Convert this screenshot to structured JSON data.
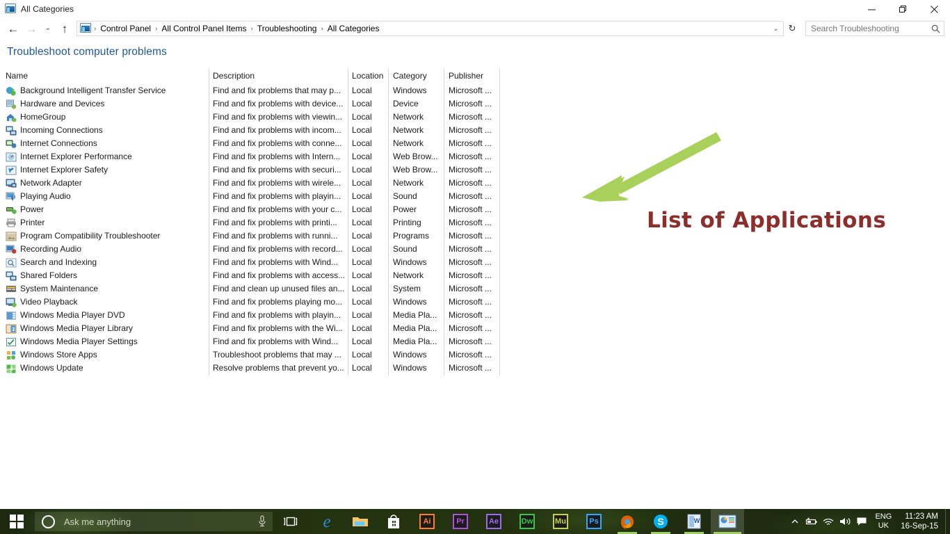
{
  "window": {
    "title": "All Categories",
    "icon": "control-panel-icon",
    "buttons": {
      "minimize": "—",
      "maximize": "❐",
      "close": "✕"
    }
  },
  "addressbar": {
    "back": "←",
    "forward": "→",
    "recent_chevron": "⌄",
    "up": "↑",
    "crumbs": [
      "Control Panel",
      "All Control Panel Items",
      "Troubleshooting",
      "All Categories"
    ],
    "separator": "›",
    "dropdown": "⌄",
    "refresh": "↻"
  },
  "search": {
    "placeholder": "Search Troubleshooting",
    "value": "",
    "icon": "search-icon"
  },
  "page": {
    "title": "Troubleshoot computer problems"
  },
  "table": {
    "columns": [
      "Name",
      "Description",
      "Location",
      "Category",
      "Publisher"
    ],
    "rows": [
      {
        "icon": "bits-icon",
        "name": "Background Intelligent Transfer Service",
        "description": "Find and fix problems that may p...",
        "location": "Local",
        "category": "Windows",
        "publisher": "Microsoft ..."
      },
      {
        "icon": "hardware-icon",
        "name": "Hardware and Devices",
        "description": "Find and fix problems with device...",
        "location": "Local",
        "category": "Device",
        "publisher": "Microsoft ..."
      },
      {
        "icon": "homegroup-icon",
        "name": "HomeGroup",
        "description": "Find and fix problems with viewin...",
        "location": "Local",
        "category": "Network",
        "publisher": "Microsoft ..."
      },
      {
        "icon": "incoming-connections-icon",
        "name": "Incoming Connections",
        "description": "Find and fix problems with incom...",
        "location": "Local",
        "category": "Network",
        "publisher": "Microsoft ..."
      },
      {
        "icon": "internet-connections-icon",
        "name": "Internet Connections",
        "description": "Find and fix problems with conne...",
        "location": "Local",
        "category": "Network",
        "publisher": "Microsoft ..."
      },
      {
        "icon": "ie-performance-icon",
        "name": "Internet Explorer Performance",
        "description": "Find and fix problems with Intern...",
        "location": "Local",
        "category": "Web Brow...",
        "publisher": "Microsoft ..."
      },
      {
        "icon": "ie-safety-icon",
        "name": "Internet Explorer Safety",
        "description": "Find and fix problems with securi...",
        "location": "Local",
        "category": "Web Brow...",
        "publisher": "Microsoft ..."
      },
      {
        "icon": "network-adapter-icon",
        "name": "Network Adapter",
        "description": "Find and fix problems with wirele...",
        "location": "Local",
        "category": "Network",
        "publisher": "Microsoft ..."
      },
      {
        "icon": "playing-audio-icon",
        "name": "Playing Audio",
        "description": "Find and fix problems with playin...",
        "location": "Local",
        "category": "Sound",
        "publisher": "Microsoft ..."
      },
      {
        "icon": "power-icon",
        "name": "Power",
        "description": "Find and fix problems with your c...",
        "location": "Local",
        "category": "Power",
        "publisher": "Microsoft ..."
      },
      {
        "icon": "printer-icon",
        "name": "Printer",
        "description": "Find and fix problems with printi...",
        "location": "Local",
        "category": "Printing",
        "publisher": "Microsoft ..."
      },
      {
        "icon": "program-compatibility-icon",
        "name": "Program Compatibility Troubleshooter",
        "description": "Find and fix problems with runni...",
        "location": "Local",
        "category": "Programs",
        "publisher": "Microsoft ..."
      },
      {
        "icon": "recording-audio-icon",
        "name": "Recording Audio",
        "description": "Find and fix problems with record...",
        "location": "Local",
        "category": "Sound",
        "publisher": "Microsoft ..."
      },
      {
        "icon": "search-indexing-icon",
        "name": "Search and Indexing",
        "description": "Find and fix problems with Wind...",
        "location": "Local",
        "category": "Windows",
        "publisher": "Microsoft ..."
      },
      {
        "icon": "shared-folders-icon",
        "name": "Shared Folders",
        "description": "Find and fix problems with access...",
        "location": "Local",
        "category": "Network",
        "publisher": "Microsoft ..."
      },
      {
        "icon": "system-maintenance-icon",
        "name": "System Maintenance",
        "description": "Find and clean up unused files an...",
        "location": "Local",
        "category": "System",
        "publisher": "Microsoft ..."
      },
      {
        "icon": "video-playback-icon",
        "name": "Video Playback",
        "description": "Find and fix problems playing mo...",
        "location": "Local",
        "category": "Windows",
        "publisher": "Microsoft ..."
      },
      {
        "icon": "wmp-dvd-icon",
        "name": "Windows Media Player DVD",
        "description": "Find and fix problems with playin...",
        "location": "Local",
        "category": "Media Pla...",
        "publisher": "Microsoft ..."
      },
      {
        "icon": "wmp-library-icon",
        "name": "Windows Media Player Library",
        "description": "Find and fix problems with the Wi...",
        "location": "Local",
        "category": "Media Pla...",
        "publisher": "Microsoft ..."
      },
      {
        "icon": "wmp-settings-icon",
        "name": "Windows Media Player Settings",
        "description": "Find and fix problems with Wind...",
        "location": "Local",
        "category": "Media Pla...",
        "publisher": "Microsoft ..."
      },
      {
        "icon": "windows-store-apps-icon",
        "name": "Windows Store Apps",
        "description": "Troubleshoot problems that may ...",
        "location": "Local",
        "category": "Windows",
        "publisher": "Microsoft ..."
      },
      {
        "icon": "windows-update-icon",
        "name": "Windows Update",
        "description": "Resolve problems that prevent yo...",
        "location": "Local",
        "category": "Windows",
        "publisher": "Microsoft ..."
      }
    ]
  },
  "annotation": {
    "label": "List of Applications",
    "text_color": "#8c2f2c",
    "arrow_color": "#a8d05a"
  },
  "taskbar": {
    "start": "windows-logo-icon",
    "cortana": {
      "placeholder": "Ask me anything",
      "value": "",
      "ring_icon": "cortana-ring-icon",
      "mic_icon": "microphone-icon"
    },
    "taskview": "task-view-icon",
    "apps": [
      {
        "name": "edge",
        "label": "e",
        "color": "#2b8ad8"
      },
      {
        "name": "file-explorer",
        "label": "",
        "color": "#f5c76a"
      },
      {
        "name": "microsoft-store",
        "label": "",
        "color": "#ffffff"
      },
      {
        "name": "illustrator",
        "label": "Ai",
        "color": "#ff7f18"
      },
      {
        "name": "premiere-pro",
        "label": "Pr",
        "color": "#b14fe0"
      },
      {
        "name": "after-effects",
        "label": "Ae",
        "color": "#9b6bf2"
      },
      {
        "name": "dreamweaver",
        "label": "Dw",
        "color": "#35c947"
      },
      {
        "name": "muse",
        "label": "Mu",
        "color": "#c9d43a"
      },
      {
        "name": "photoshop",
        "label": "Ps",
        "color": "#31a8ff"
      },
      {
        "name": "firefox",
        "label": "",
        "color": "#e66000"
      },
      {
        "name": "skype",
        "label": "S",
        "color": "#00aff0"
      },
      {
        "name": "word",
        "label": "W",
        "color": "#2b579a"
      },
      {
        "name": "control-panel",
        "label": "",
        "color": "#4a90d9"
      }
    ],
    "tray": {
      "chevron": "show-hidden-icons",
      "battery": "battery-icon",
      "network": "wifi-icon",
      "volume": "volume-icon",
      "action_center": "notifications-icon",
      "lang_line1": "ENG",
      "lang_line2": "UK",
      "time": "11:23 AM",
      "date": "16-Sep-15"
    }
  }
}
